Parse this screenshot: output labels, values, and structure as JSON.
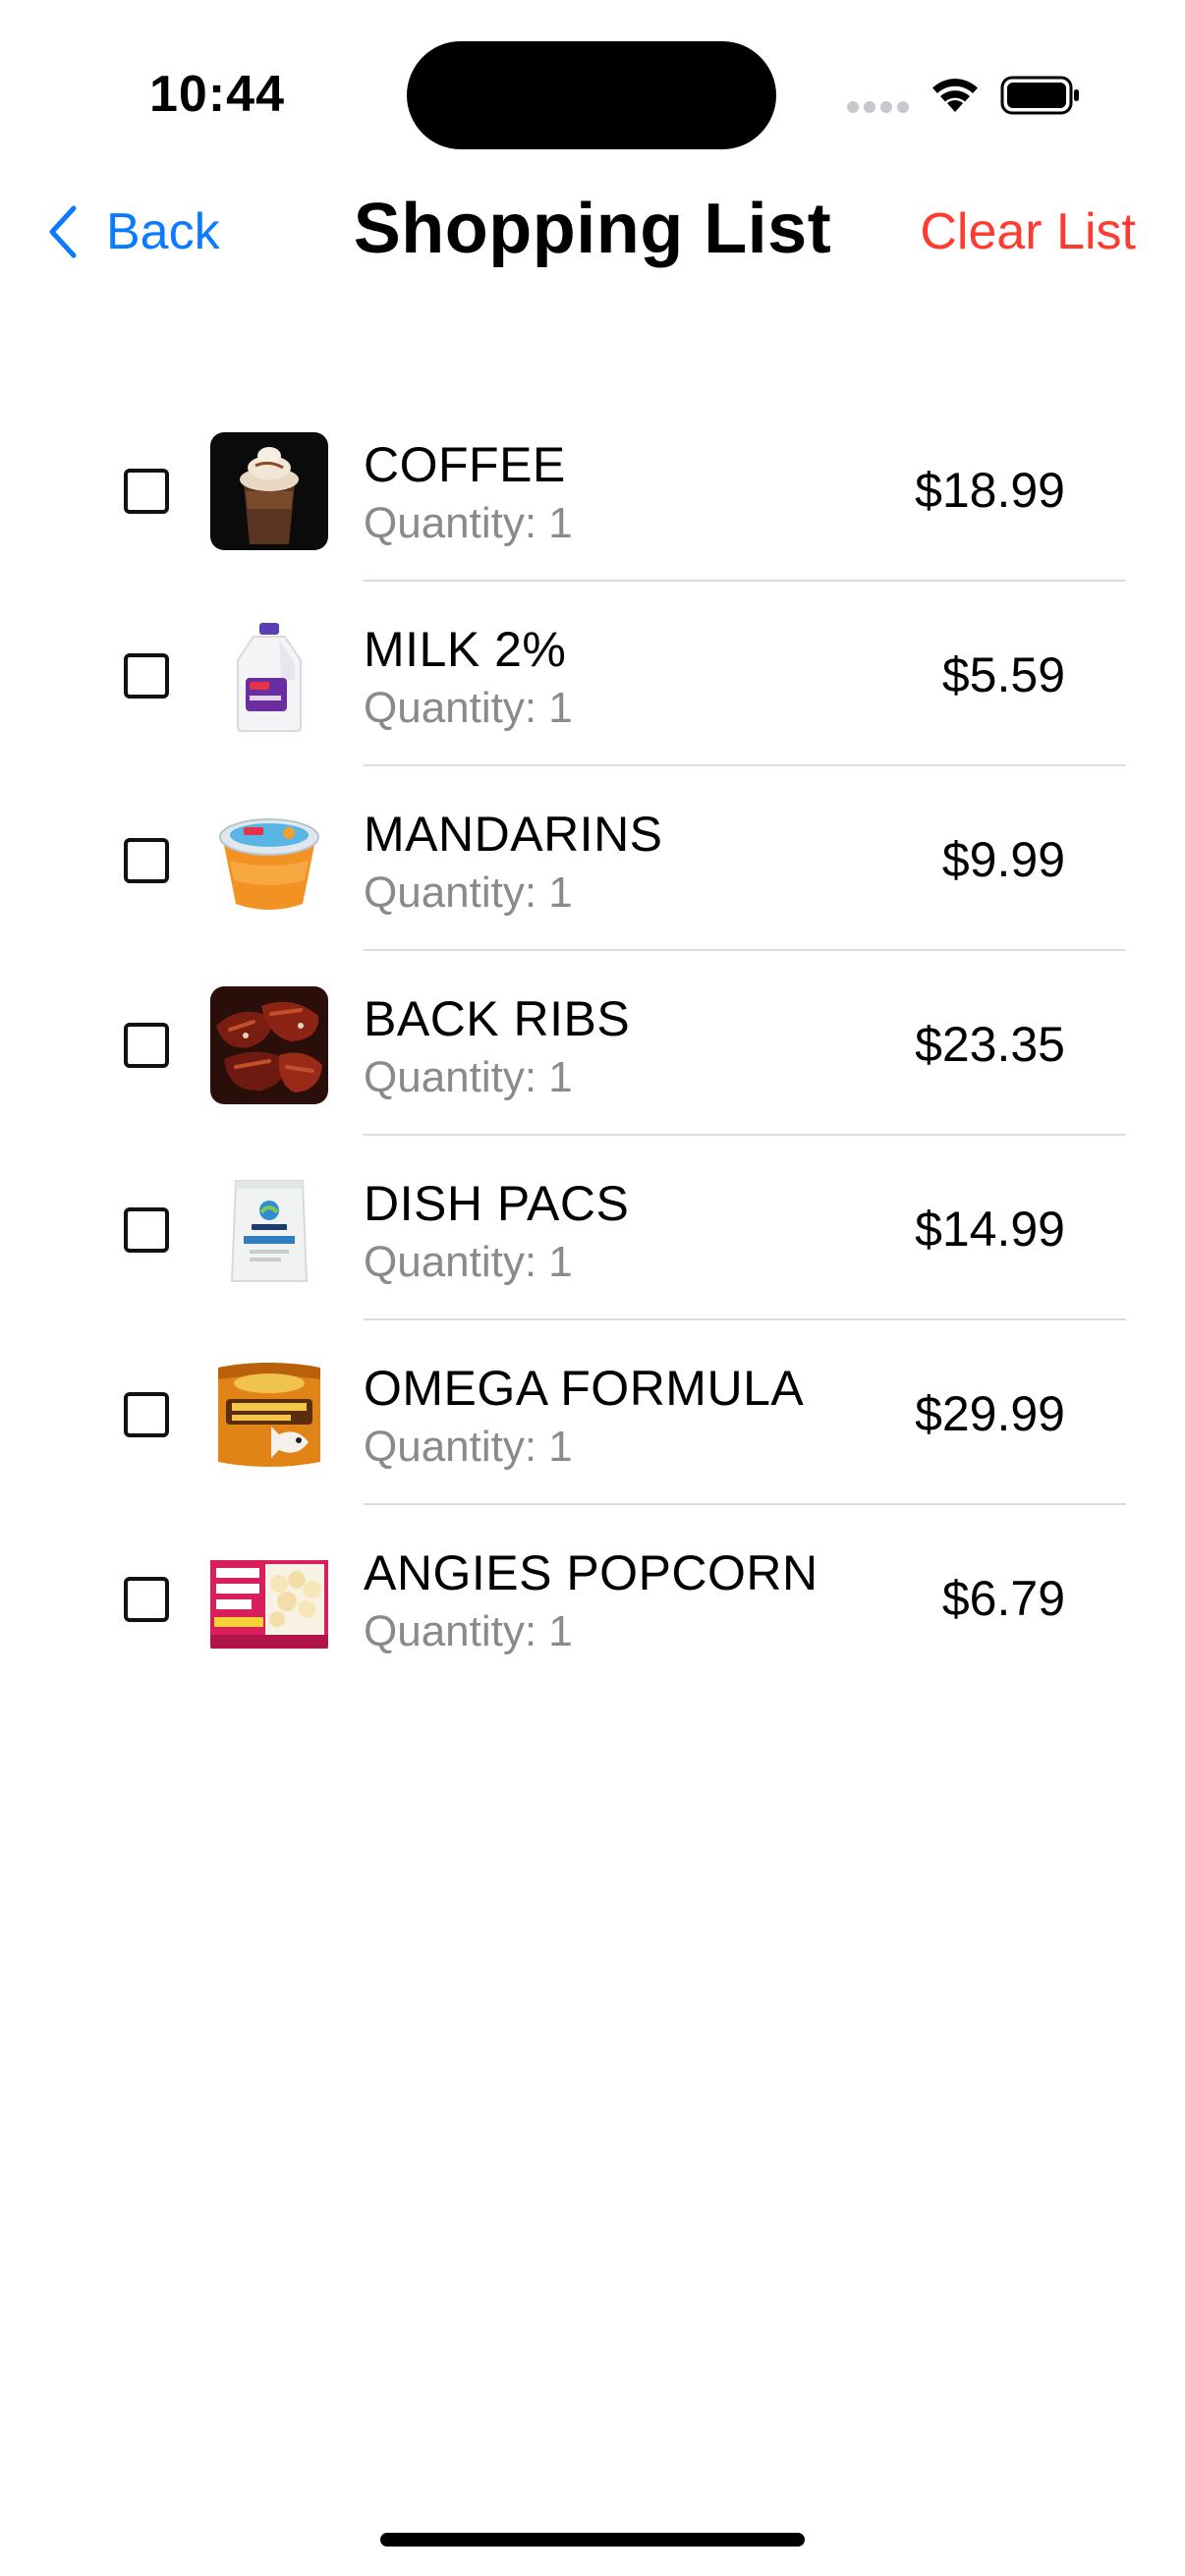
{
  "status": {
    "time": "10:44"
  },
  "nav": {
    "back_label": "Back",
    "title": "Shopping List",
    "clear_label": "Clear List"
  },
  "items": [
    {
      "name": "COFFEE",
      "quantity": "Quantity: 1",
      "price": "$18.99",
      "icon": "coffee-icon"
    },
    {
      "name": "MILK 2%",
      "quantity": "Quantity: 1",
      "price": "$5.59",
      "icon": "milk-jug-icon"
    },
    {
      "name": "MANDARINS",
      "quantity": "Quantity: 1",
      "price": "$9.99",
      "icon": "mandarin-cup-icon"
    },
    {
      "name": "BACK RIBS",
      "quantity": "Quantity: 1",
      "price": "$23.35",
      "icon": "ribs-icon"
    },
    {
      "name": "DISH PACS",
      "quantity": "Quantity: 1",
      "price": "$14.99",
      "icon": "dish-pacs-bag-icon"
    },
    {
      "name": "OMEGA FORMULA",
      "quantity": "Quantity: 1",
      "price": "$29.99",
      "icon": "fish-food-can-icon"
    },
    {
      "name": "ANGIES POPCORN",
      "quantity": "Quantity: 1",
      "price": "$6.79",
      "icon": "popcorn-box-icon"
    }
  ],
  "colors": {
    "accent": "#0a7aff",
    "destructive": "#ff3b30",
    "secondary_text": "#8a8a8e"
  }
}
